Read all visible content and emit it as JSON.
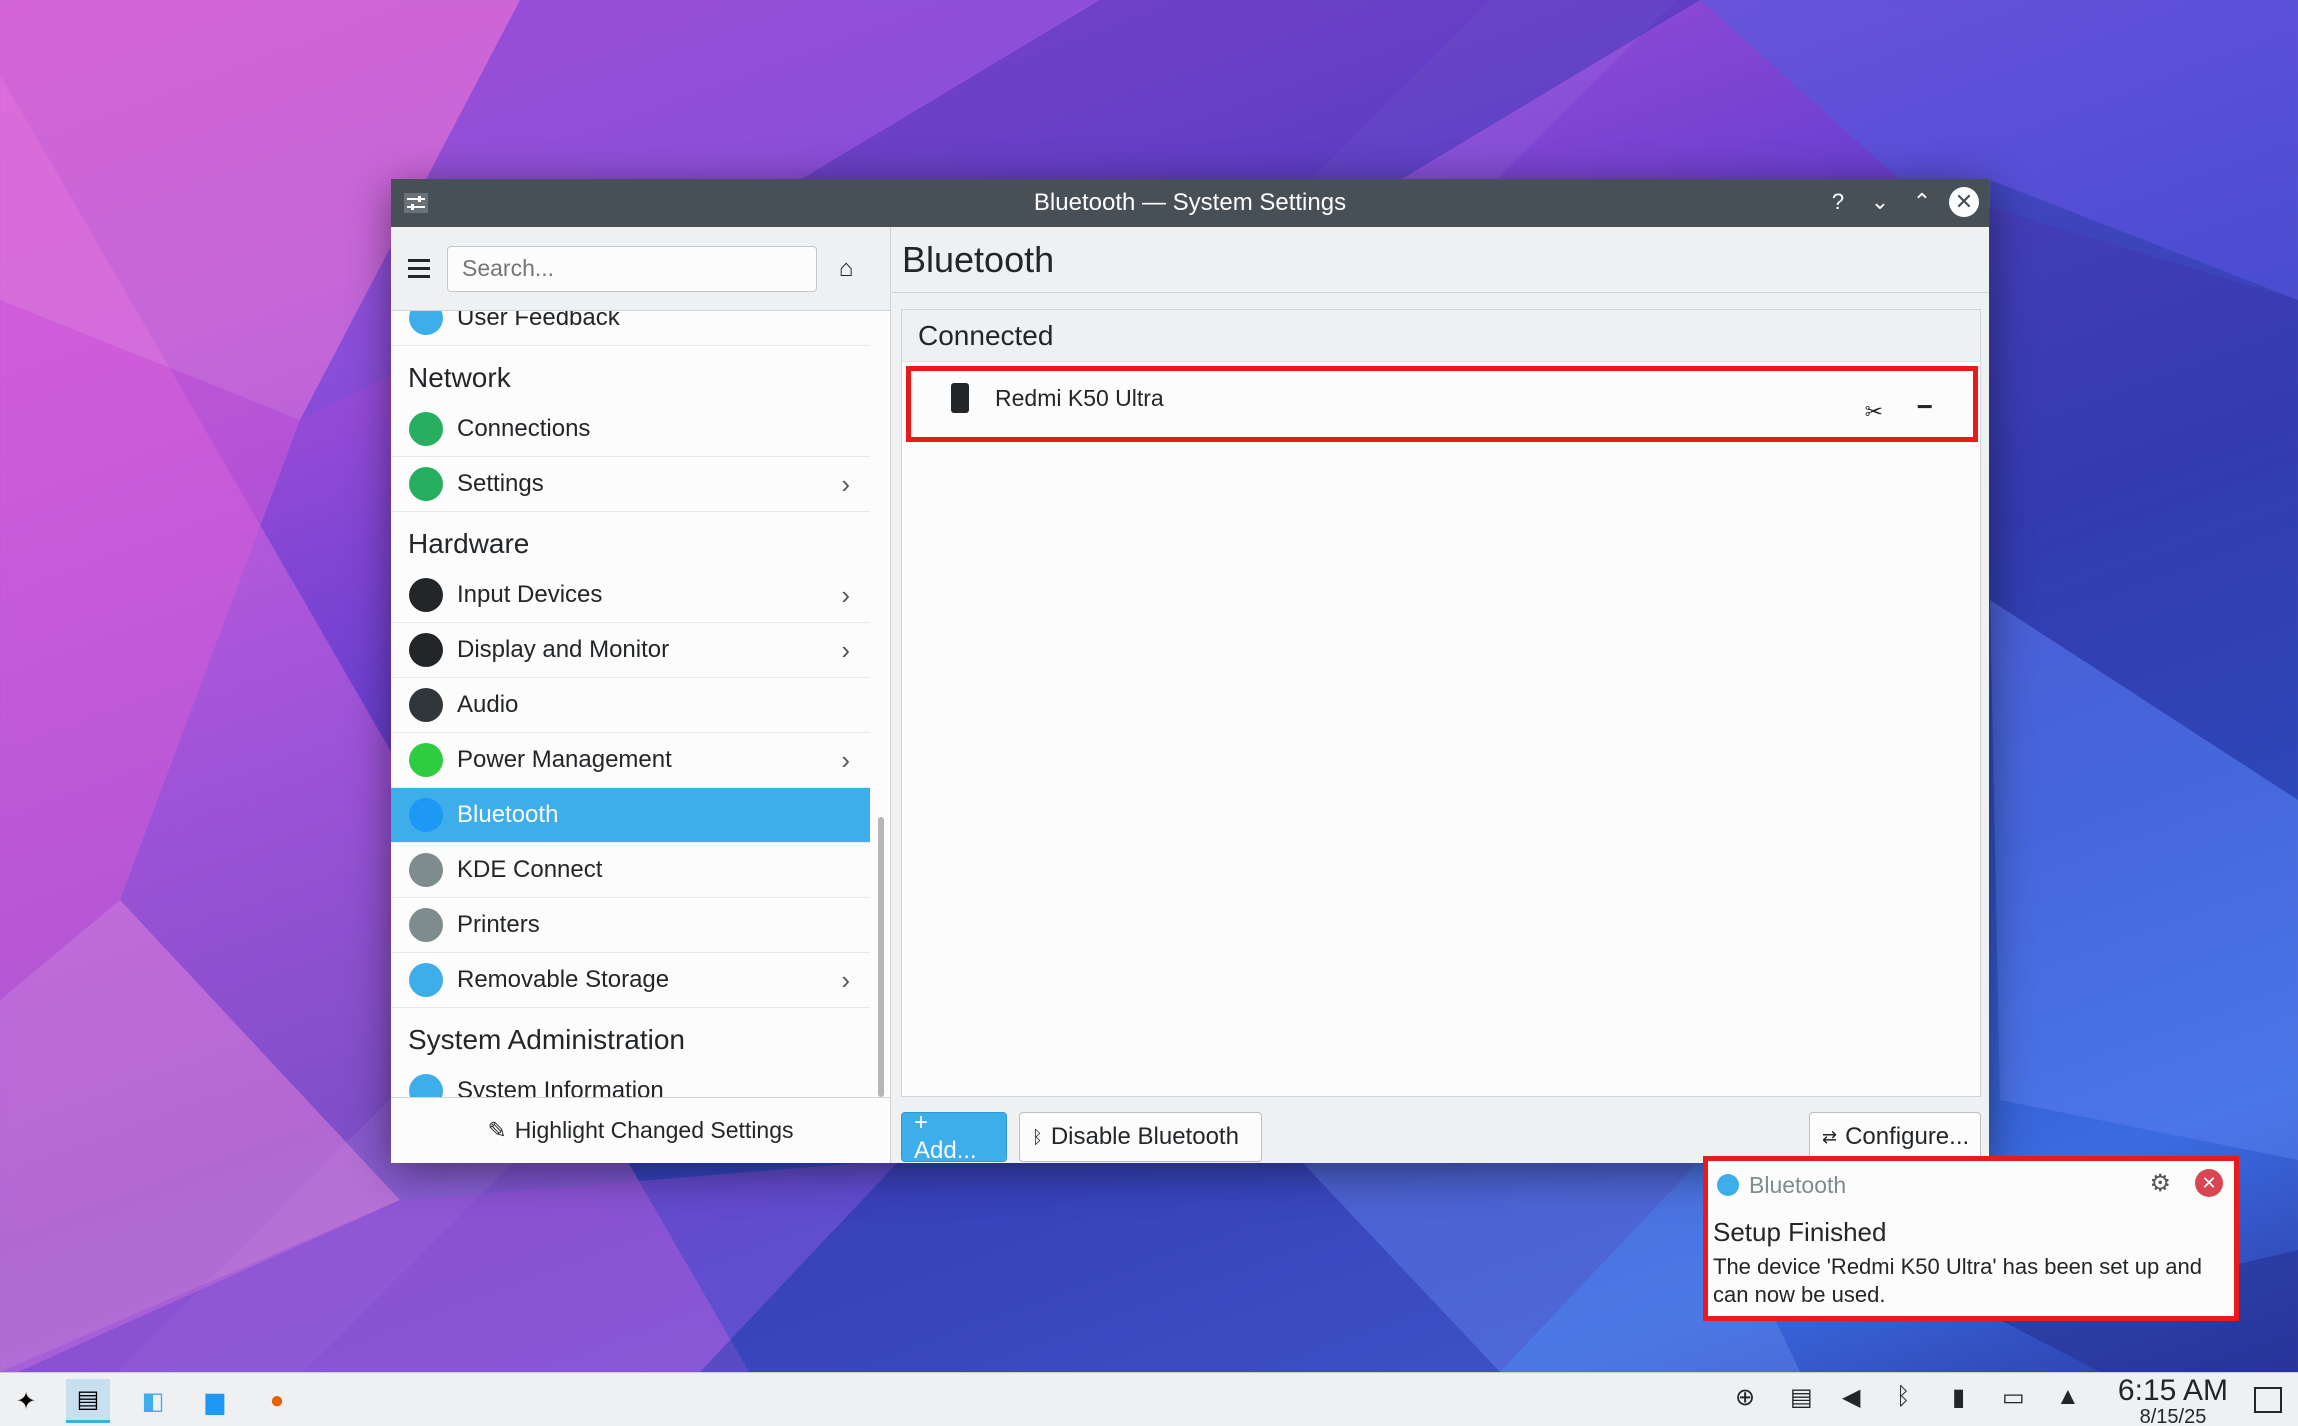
{
  "window": {
    "title": "Bluetooth — System Settings",
    "help": "?",
    "minimize": "⌄",
    "maximize": "⌃",
    "close": "✕"
  },
  "sidebar": {
    "search_placeholder": "Search...",
    "items": [
      {
        "type": "item",
        "label": "User Feedback",
        "icon": "feedback-icon",
        "color": "#3daee9",
        "chevron": false
      },
      {
        "type": "section",
        "label": "Network"
      },
      {
        "type": "item",
        "label": "Connections",
        "icon": "globe-icon",
        "color": "#27ae60",
        "chevron": false
      },
      {
        "type": "item",
        "label": "Settings",
        "icon": "globe-icon",
        "color": "#27ae60",
        "chevron": true
      },
      {
        "type": "section",
        "label": "Hardware"
      },
      {
        "type": "item",
        "label": "Input Devices",
        "icon": "keyboard-icon",
        "color": "#232629",
        "chevron": true
      },
      {
        "type": "item",
        "label": "Display and Monitor",
        "icon": "monitor-icon",
        "color": "#232629",
        "chevron": true
      },
      {
        "type": "item",
        "label": "Audio",
        "icon": "speaker-icon",
        "color": "#31363b",
        "chevron": false
      },
      {
        "type": "item",
        "label": "Power Management",
        "icon": "power-icon",
        "color": "#2ecc40",
        "chevron": true
      },
      {
        "type": "item",
        "label": "Bluetooth",
        "icon": "bluetooth-icon",
        "color": "#1d99f3",
        "chevron": false,
        "active": true
      },
      {
        "type": "item",
        "label": "KDE Connect",
        "icon": "phone-icon",
        "color": "#7f8c8d",
        "chevron": false
      },
      {
        "type": "item",
        "label": "Printers",
        "icon": "printer-icon",
        "color": "#7f8c8d",
        "chevron": false
      },
      {
        "type": "item",
        "label": "Removable Storage",
        "icon": "usb-icon",
        "color": "#3daee9",
        "chevron": true
      },
      {
        "type": "section",
        "label": "System Administration"
      },
      {
        "type": "item",
        "label": "System Information",
        "icon": "info-icon",
        "color": "#3daee9",
        "chevron": false
      }
    ],
    "highlight_label": "Highlight Changed Settings"
  },
  "main": {
    "title": "Bluetooth",
    "section": "Connected",
    "device_name": "Redmi K50 Ultra",
    "add_label": "+ Add...",
    "disable_label": "Disable Bluetooth",
    "configure_label": "Configure..."
  },
  "notification": {
    "app": "Bluetooth",
    "heading": "Setup Finished",
    "body": "The device 'Redmi K50 Ultra' has been set up and can now be used."
  },
  "taskbar": {
    "time": "6:15 AM",
    "date": "8/15/25"
  },
  "colors": {
    "accent": "#3daee9",
    "highlight_box": "#e81a1a",
    "titlebar": "#475057"
  }
}
